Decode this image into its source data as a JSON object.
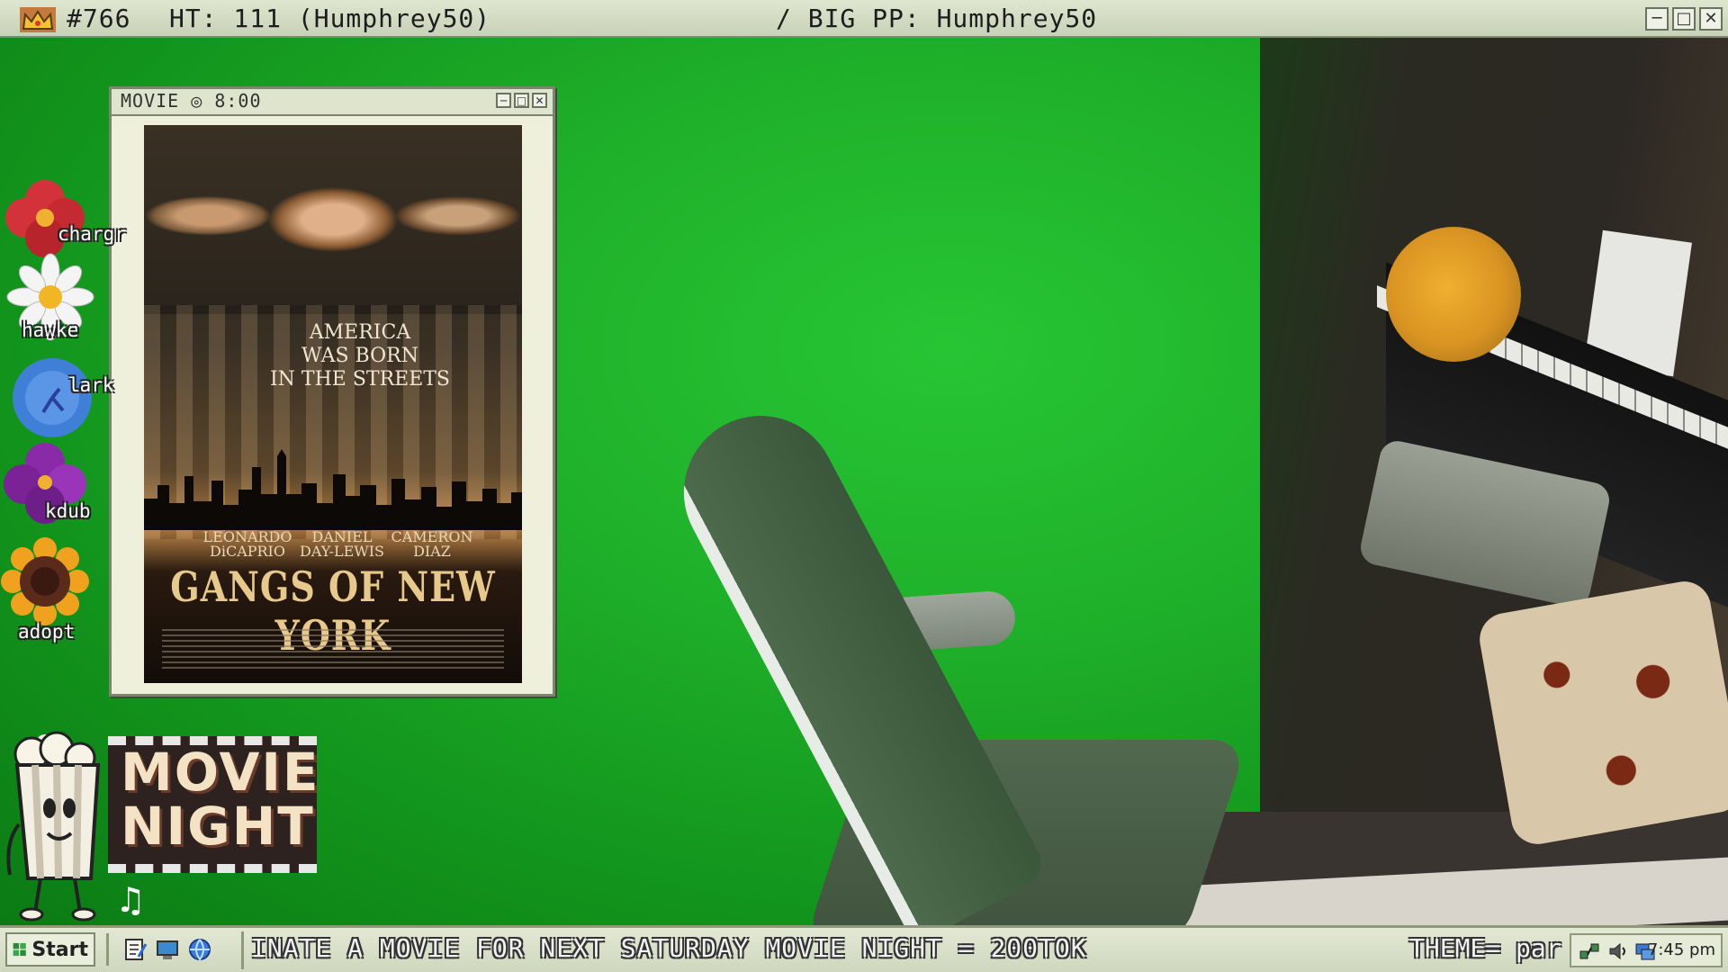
{
  "titlebar": {
    "rank": "#766",
    "ht": "HT: 111 (Humphrey50)",
    "big_pp": "/ BIG PP: Humphrey50",
    "buttons": [
      "minimize",
      "maximize",
      "close"
    ]
  },
  "movie_window": {
    "title": "MOVIE ◎ 8:00",
    "poster": {
      "tagline": "AMERICA\nWAS BORN\nIN THE STREETS",
      "cast": [
        "LEONARDO\nDiCAPRIO",
        "DANIEL\nDAY-LEWIS",
        "CAMERON\nDIAZ"
      ],
      "title": "GANGS OF NEW YORK"
    }
  },
  "sidebar_flowers": [
    {
      "label": "chargr",
      "color": "#d3323a"
    },
    {
      "label": "hawke",
      "color": "#f4f4f4"
    },
    {
      "label": "lark",
      "color": "#3f7fd8"
    },
    {
      "label": "kdub",
      "color": "#8a2aa8"
    },
    {
      "label": "adopt",
      "color": "#f0a21e"
    }
  ],
  "movie_night_badge": {
    "line1": "MOVIE",
    "line2": "NIGHT"
  },
  "music_note": "♫",
  "taskbar": {
    "start_label": "Start",
    "ticker": "INATE A MOVIE FOR NEXT SATURDAY MOVIE NIGHT = 200TOK",
    "theme": "THEME= par",
    "clock": "7:45 pm"
  },
  "icons": {
    "crown": "crown-icon",
    "start": "start-icon",
    "quick_launch": [
      "notepad-icon",
      "desktop-icon",
      "browser-icon"
    ],
    "tray": [
      "network-icon",
      "volume-icon",
      "display-icon"
    ]
  }
}
